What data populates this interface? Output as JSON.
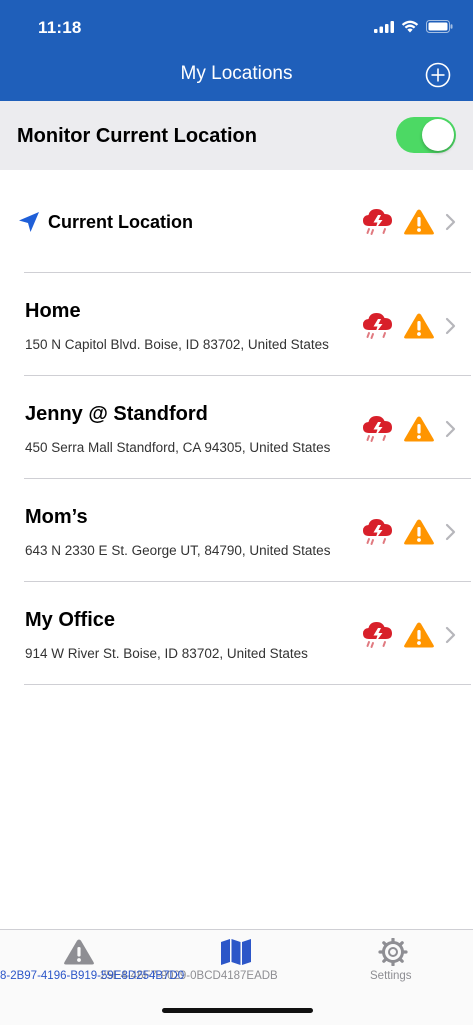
{
  "status_bar": {
    "time": "11:18"
  },
  "header": {
    "title": "My Locations",
    "add_icon": "plus-circle-icon"
  },
  "monitor": {
    "label": "Monitor Current Location",
    "enabled": true,
    "toggle_color": "#4cd964"
  },
  "locations": [
    {
      "name": "Current Location",
      "address": "",
      "icons": [
        "storm-icon",
        "warning-icon",
        "chevron-right-icon"
      ]
    },
    {
      "name": "Home",
      "address": "150 N Capitol Blvd. Boise, ID 83702, United States",
      "icons": [
        "storm-icon",
        "warning-icon",
        "chevron-right-icon"
      ]
    },
    {
      "name": "Jenny @ Standford",
      "address": "450 Serra Mall Standford, CA 94305, United States",
      "icons": [
        "storm-icon",
        "warning-icon",
        "chevron-right-icon"
      ]
    },
    {
      "name": "Mom’s",
      "address": "643 N 2330 E St. George UT, 84790, United States",
      "icons": [
        "storm-icon",
        "warning-icon",
        "chevron-right-icon"
      ]
    },
    {
      "name": "My Office",
      "address": "914 W River St. Boise, ID 83702, United States",
      "icons": [
        "storm-icon",
        "warning-icon",
        "chevron-right-icon"
      ]
    }
  ],
  "tabbar": {
    "alerts_label": "8-2B97-4196-B919-59E8D254B7D0",
    "map_label": "25E4-46F7-9029-0BCD4187EADB",
    "settings_label": "Settings"
  },
  "colors": {
    "header": "#1f5fba",
    "accent": "#2c56c8",
    "storm": "#d8202a",
    "warning": "#ff9500"
  }
}
